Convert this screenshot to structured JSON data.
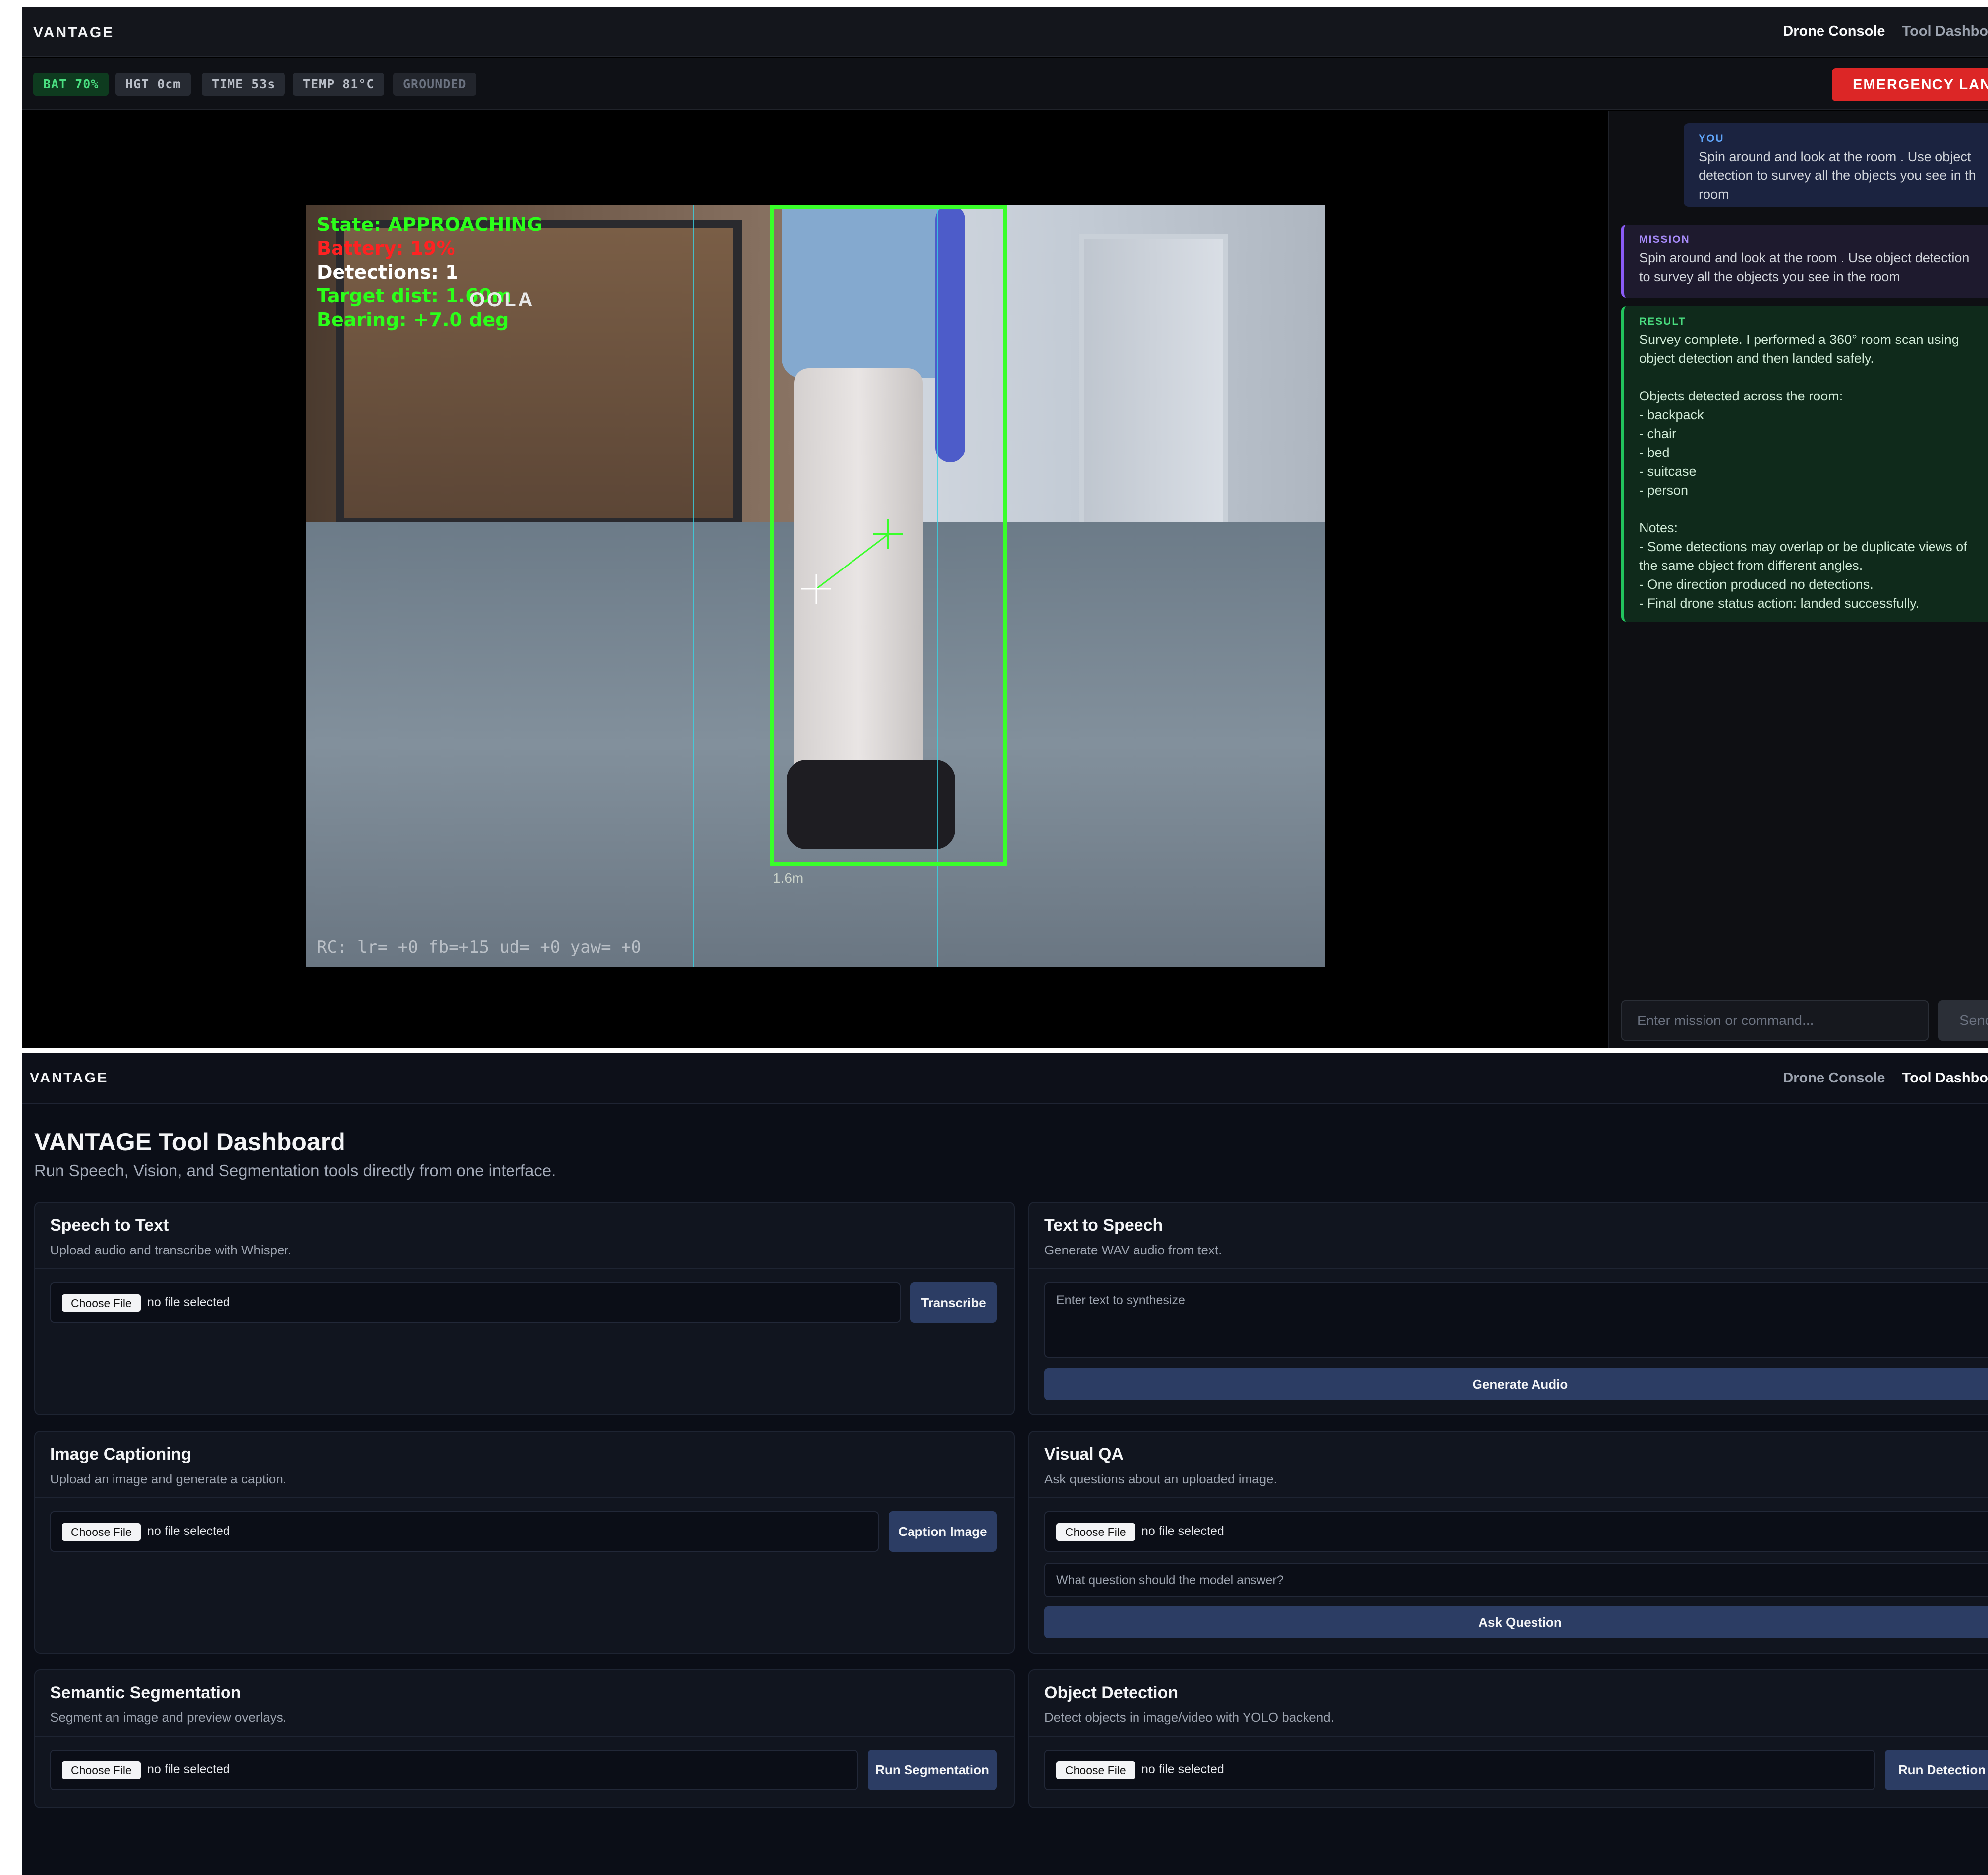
{
  "console": {
    "brand": "VANTAGE",
    "nav": [
      "Drone Console",
      "Tool Dashbo"
    ],
    "status": {
      "battery": "BAT 70%",
      "height": "HGT 0cm",
      "time": "TIME 53s",
      "temp": "TEMP 81°C",
      "state": "GROUNDED"
    },
    "emergency_label": "EMERGENCY LAND",
    "video": {
      "osd_state": "State: APPROACHING",
      "osd_battery": "Battery: 19%",
      "osd_detections": "Detections: 1",
      "osd_target": "Target dist: 1.60m",
      "osd_bearing": "Bearing: +7.0 deg",
      "brand_overlay": "OOLA",
      "bbox_label": "1.6m",
      "rc_line": "RC: lr= +0 fb=+15 ud= +0 yaw= +0"
    },
    "chat": {
      "you_tag": "YOU",
      "you_text": "Spin around and look at the room . Use object detection to survey all the objects you see in th room",
      "mission_tag": "MISSION",
      "mission_text": "Spin around and look at the room . Use object detection to survey all the objects you see in the room",
      "result_tag": "RESULT",
      "result_text": "Survey complete. I performed a 360° room scan using object detection and then landed safely.\n\nObjects detected across the room:\n- backpack\n- chair\n- bed\n- suitcase\n- person\n\nNotes:\n- Some detections may overlap or be duplicate views of the same object from different angles.\n- One direction produced no detections.\n- Final drone status action: landed successfully.",
      "input_placeholder": "Enter mission or command...",
      "send_label": "Send"
    }
  },
  "dashboard": {
    "brand": "VANTAGE",
    "nav": [
      "Drone Console",
      "Tool Dashbo"
    ],
    "title": "VANTAGE Tool Dashboard",
    "subtitle": "Run Speech, Vision, and Segmentation tools directly from one interface.",
    "choose_file": "Choose File",
    "no_file": "no file selected",
    "stt": {
      "title": "Speech to Text",
      "desc": "Upload audio and transcribe with Whisper.",
      "button": "Transcribe"
    },
    "tts": {
      "title": "Text to Speech",
      "desc": "Generate WAV audio from text.",
      "placeholder": "Enter text to synthesize",
      "button": "Generate Audio"
    },
    "caption": {
      "title": "Image Captioning",
      "desc": "Upload an image and generate a caption.",
      "button": "Caption Image"
    },
    "vqa": {
      "title": "Visual QA",
      "desc": "Ask questions about an uploaded image.",
      "placeholder": "What question should the model answer?",
      "button": "Ask Question"
    },
    "seg": {
      "title": "Semantic Segmentation",
      "desc": "Segment an image and preview overlays.",
      "button": "Run Segmentation"
    },
    "det": {
      "title": "Object Detection",
      "desc": "Detect objects in image/video with YOLO backend.",
      "button": "Run Detection"
    }
  },
  "colors": {
    "accent_emergency": "#dc2626",
    "detection_box": "#39ff2a",
    "button_primary": "#2c3d64",
    "mission_border": "#8b5cf6",
    "result_border": "#22c55e"
  }
}
